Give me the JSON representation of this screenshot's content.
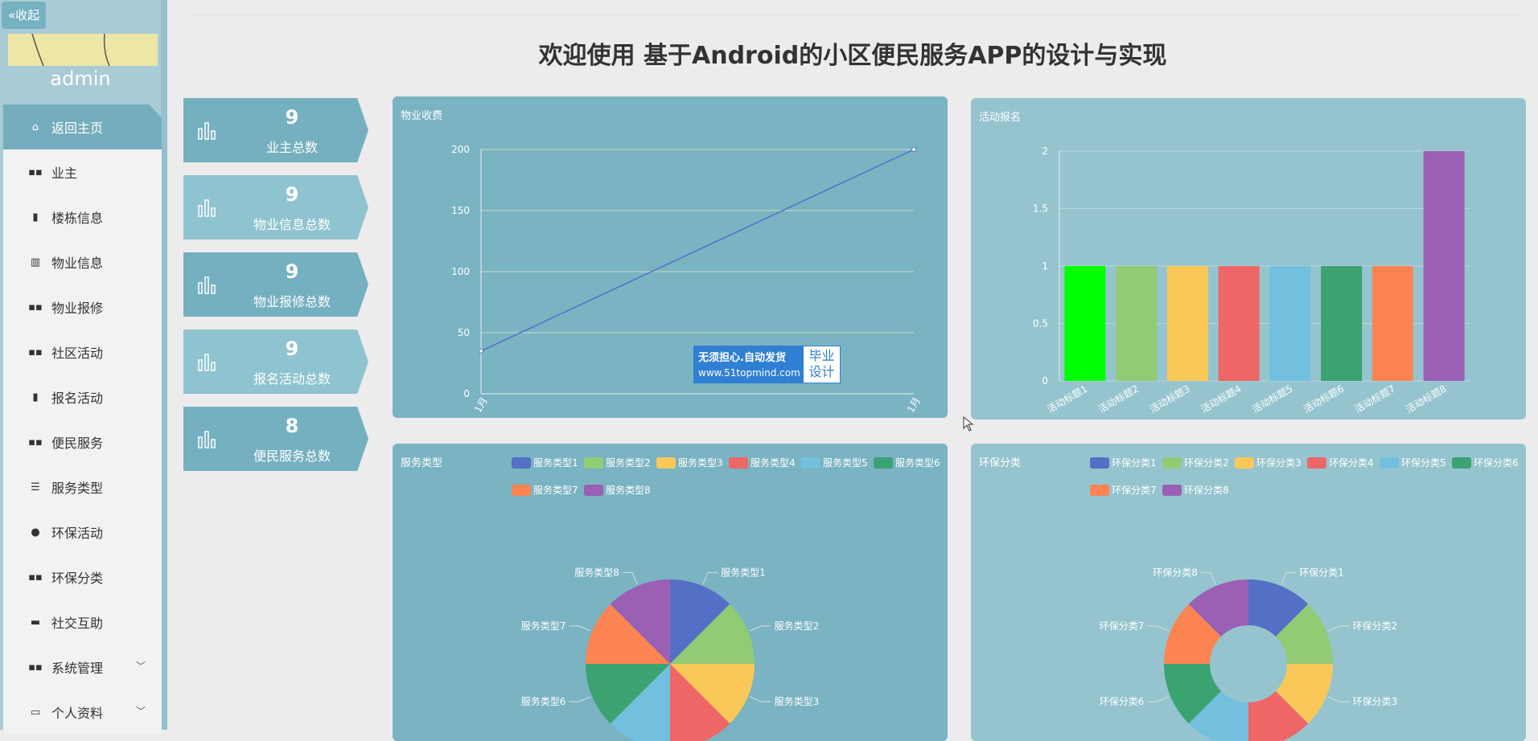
{
  "sidebar": {
    "collapse_label": "«收起",
    "user_name": "admin",
    "menu": [
      {
        "label": "返回主页",
        "icon": "home-icon",
        "active": true
      },
      {
        "label": "业主",
        "icon": "grid-icon"
      },
      {
        "label": "楼栋信息",
        "icon": "clipboard-icon"
      },
      {
        "label": "物业信息",
        "icon": "bars-icon"
      },
      {
        "label": "物业报修",
        "icon": "grid-icon"
      },
      {
        "label": "社区活动",
        "icon": "grid-icon"
      },
      {
        "label": "报名活动",
        "icon": "clipboard-icon"
      },
      {
        "label": "便民服务",
        "icon": "grid-icon"
      },
      {
        "label": "服务类型",
        "icon": "list-icon"
      },
      {
        "label": "环保活动",
        "icon": "leaf-icon"
      },
      {
        "label": "环保分类",
        "icon": "grid-icon"
      },
      {
        "label": "社交互助",
        "icon": "chat-icon"
      },
      {
        "label": "系统管理",
        "icon": "grid-icon",
        "expandable": true
      },
      {
        "label": "个人资料",
        "icon": "card-icon",
        "expandable": true
      }
    ]
  },
  "header": {
    "title": "欢迎使用 基于Android的小区便民服务APP的设计与实现"
  },
  "stats": [
    {
      "value": "9",
      "label": "业主总数"
    },
    {
      "value": "9",
      "label": "物业信息总数"
    },
    {
      "value": "9",
      "label": "物业报修总数"
    },
    {
      "value": "9",
      "label": "报名活动总数"
    },
    {
      "value": "8",
      "label": "便民服务总数"
    }
  ],
  "panels": {
    "property_fee": "物业收费",
    "activity_signup": "活动报名",
    "service_type": "服务类型",
    "eco_category": "环保分类"
  },
  "watermark": {
    "line1": "无须担心.自动发货",
    "line2": "www.51topmind.com",
    "side_line1": "毕业",
    "side_line2": "设计"
  },
  "colors": {
    "palette": [
      "#5470c6",
      "#91cc75",
      "#fac858",
      "#ee6666",
      "#73c0de",
      "#3ba272",
      "#fc8452",
      "#9a60b4"
    ],
    "bar_first": "#00ff00",
    "line": "#5470c6"
  },
  "chart_data": [
    {
      "type": "line",
      "title": "物业收费",
      "x": [
        "1月",
        "1月"
      ],
      "values": [
        35,
        200
      ],
      "ylim": [
        0,
        200
      ],
      "yticks": [
        0,
        50,
        100,
        150,
        200
      ],
      "grid": true
    },
    {
      "type": "bar",
      "title": "活动报名",
      "categories": [
        "活动标题1",
        "活动标题2",
        "活动标题3",
        "活动标题4",
        "活动标题5",
        "活动标题6",
        "活动标题7",
        "活动标题8"
      ],
      "values": [
        1,
        1,
        1,
        1,
        1,
        1,
        1,
        2
      ],
      "ylim": [
        0,
        2
      ],
      "yticks": [
        "0",
        "0.5",
        "1",
        "1.5",
        "2"
      ],
      "grid": true
    },
    {
      "type": "pie",
      "title": "服务类型",
      "categories": [
        "服务类型1",
        "服务类型2",
        "服务类型3",
        "服务类型4",
        "服务类型5",
        "服务类型6",
        "服务类型7",
        "服务类型8"
      ],
      "values": [
        1,
        1,
        1,
        1,
        1,
        1,
        1,
        1
      ],
      "legend": "top-right"
    },
    {
      "type": "pie",
      "donut": true,
      "title": "环保分类",
      "categories": [
        "环保分类1",
        "环保分类2",
        "环保分类3",
        "环保分类4",
        "环保分类5",
        "环保分类6",
        "环保分类7",
        "环保分类8"
      ],
      "values": [
        1,
        1,
        1,
        1,
        1,
        1,
        1,
        1
      ],
      "legend": "top-right"
    }
  ]
}
